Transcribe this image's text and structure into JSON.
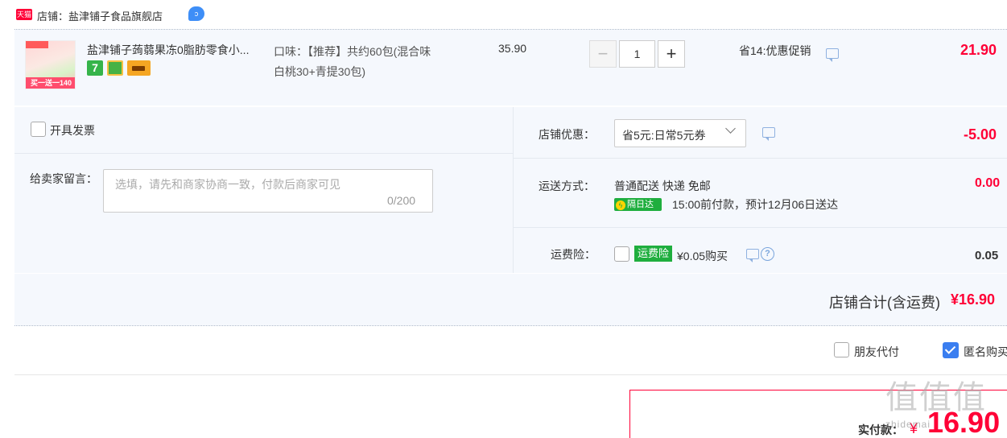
{
  "shop": {
    "badge": "天猫",
    "label": "店铺：盐津铺子食品旗舰店",
    "chat_icon": "chat-bubble-icon"
  },
  "item": {
    "thumb_caption": "买一送一140",
    "title": "盐津铺子蒟蒻果冻0脂肪零食小...",
    "service_badge": "7",
    "sku_line1": "口味：【推荐】共约60包(混合味",
    "sku_line2": "白桃30+青提30包)",
    "unit_price": "35.90",
    "qty_minus": "−",
    "quantity": "1",
    "qty_plus": "+",
    "promo": "省14:优惠促销",
    "total": "21.90"
  },
  "options": {
    "invoice_label": "开具发票",
    "note_label": "给卖家留言：",
    "note_placeholder": "选填，请先和商家协商一致，付款后商家可见",
    "note_count": "0/200",
    "coupon_label": "店铺优惠：",
    "coupon_selected": "省5元:日常5元券",
    "coupon_amount": "-5.00",
    "shipping_label": "运送方式：",
    "shipping_method": "普通配送 快递 免邮",
    "nextday_badge": "隔日达",
    "shipping_eta": "15:00前付款，预计12月06日送达",
    "shipping_fee": "0.00",
    "insurance_label": "运费险：",
    "insurance_badge": "运费险",
    "insurance_price": "¥0.05购买",
    "insurance_fee": "0.05"
  },
  "summary": {
    "total_label": "店铺合计(含运费)",
    "total_value": "¥16.90",
    "friend_pay": "朋友代付",
    "anonymous": "匿名购买",
    "pay_label": "实付款：",
    "pay_yen": "¥",
    "pay_value": "16.90"
  },
  "watermark": {
    "text": "值值值",
    "site": "zhidemai"
  },
  "colors": {
    "price_red": "#ff0036",
    "panel_bg": "#f5f8fd",
    "check_blue": "#3a7ef0",
    "green": "#1fae3e"
  }
}
